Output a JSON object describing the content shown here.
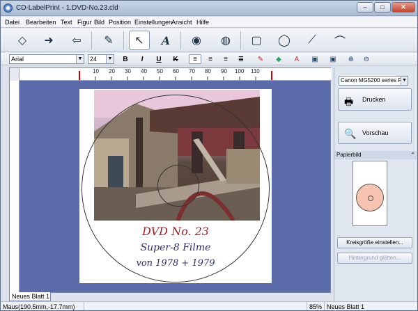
{
  "window": {
    "title": "CD-LabelPrint - 1.DVD-No.23.cld"
  },
  "menu": [
    "Datei",
    "Bearbeiten",
    "Text",
    "Figur",
    "Bild",
    "Position",
    "Einstellungen",
    "Ansicht",
    "Hilfe"
  ],
  "toolbar": {
    "icons": [
      "label-icon",
      "open-icon",
      "import-icon",
      "paint-icon",
      "pointer-icon",
      "text-icon",
      "cd-icon",
      "circle-image-icon",
      "rectangle-icon",
      "ellipse-icon",
      "line-icon",
      "arc-icon"
    ]
  },
  "fontbar": {
    "font_name": "Arial",
    "font_size": "24",
    "bold": "B",
    "italic": "I",
    "underline": "U",
    "strike": "K"
  },
  "ruler": {
    "ticks": [
      "10",
      "20",
      "30",
      "40",
      "50",
      "60",
      "70",
      "80",
      "90",
      "100",
      "110"
    ]
  },
  "label": {
    "line1": "DVD No. 23",
    "line2": "Super-8 Filme",
    "line3": "von 1978 + 1979"
  },
  "sheet_tab": "Neues Blatt 1",
  "status": {
    "mouse": "Maus(190.5mm,-17.7mm)",
    "zoom": "85%",
    "sheet": "Neues Blatt 1"
  },
  "panel": {
    "printer": "Canon MG5200 series F",
    "print_label": "Drucken",
    "preview_label": "Vorschau",
    "paper_section": "Papierbild",
    "disc_size_label": "Kreisgröße einstellen...",
    "bg_label": "Hintergrund glätten..."
  }
}
